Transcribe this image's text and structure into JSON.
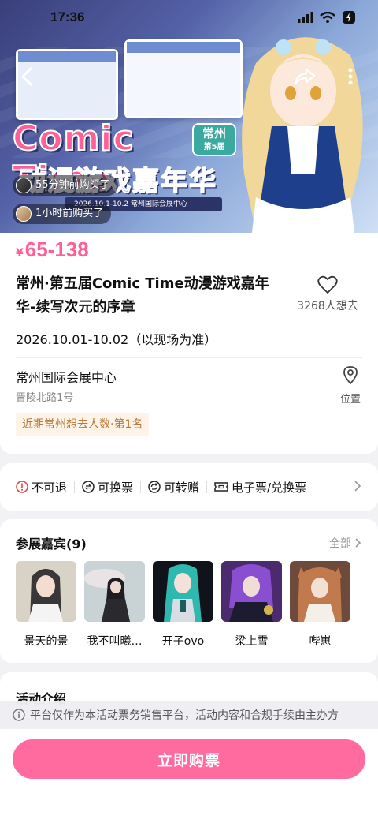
{
  "status_bar": {
    "time": "17:36"
  },
  "banner": {
    "logo_title": "Comic Time",
    "logo_subtitle": "动漫游戏嘉年华",
    "city_badge": "常州",
    "edition_badge": "第5届",
    "date_strip": "2026.10.1-10.2   常州国际会展中心",
    "buyer_tags": [
      "55分钟前购买了",
      "1小时前购买了"
    ]
  },
  "info": {
    "price_currency": "¥",
    "price_range": "65-138",
    "title": "常州·第五届Comic Time动漫游戏嘉年华-续写次元的序章",
    "fav_count": "3268人想去",
    "date": "2026.10.01-10.02（以现场为准）",
    "venue_name": "常州国际会展中心",
    "venue_address": "晋陵北路1号",
    "location_label": "位置",
    "rank_badge": "近期常州想去人数·第1名"
  },
  "policies": [
    {
      "icon": "warning-icon",
      "label": "不可退"
    },
    {
      "icon": "exchange-icon",
      "label": "可换票"
    },
    {
      "icon": "transfer-icon",
      "label": "可转赠"
    },
    {
      "icon": "ticket-icon",
      "label": "电子票/兑换票"
    }
  ],
  "guests": {
    "title": "参展嘉宾(9)",
    "all_label": "全部",
    "items": [
      {
        "name": "景天的景"
      },
      {
        "name": "我不叫曦…"
      },
      {
        "name": "开子ovo"
      },
      {
        "name": "梁上雪"
      },
      {
        "name": "哔崽"
      }
    ]
  },
  "intro": {
    "title": "活动介绍"
  },
  "notice": "平台仅作为本活动票务销售平台，活动内容和合规手续由主办方",
  "buy_button": "立即购票",
  "colors": {
    "accent": "#ff6b9e",
    "price": "#ff5f97",
    "rank_text": "#b9773a",
    "rank_bg": "#fdf3e6"
  }
}
